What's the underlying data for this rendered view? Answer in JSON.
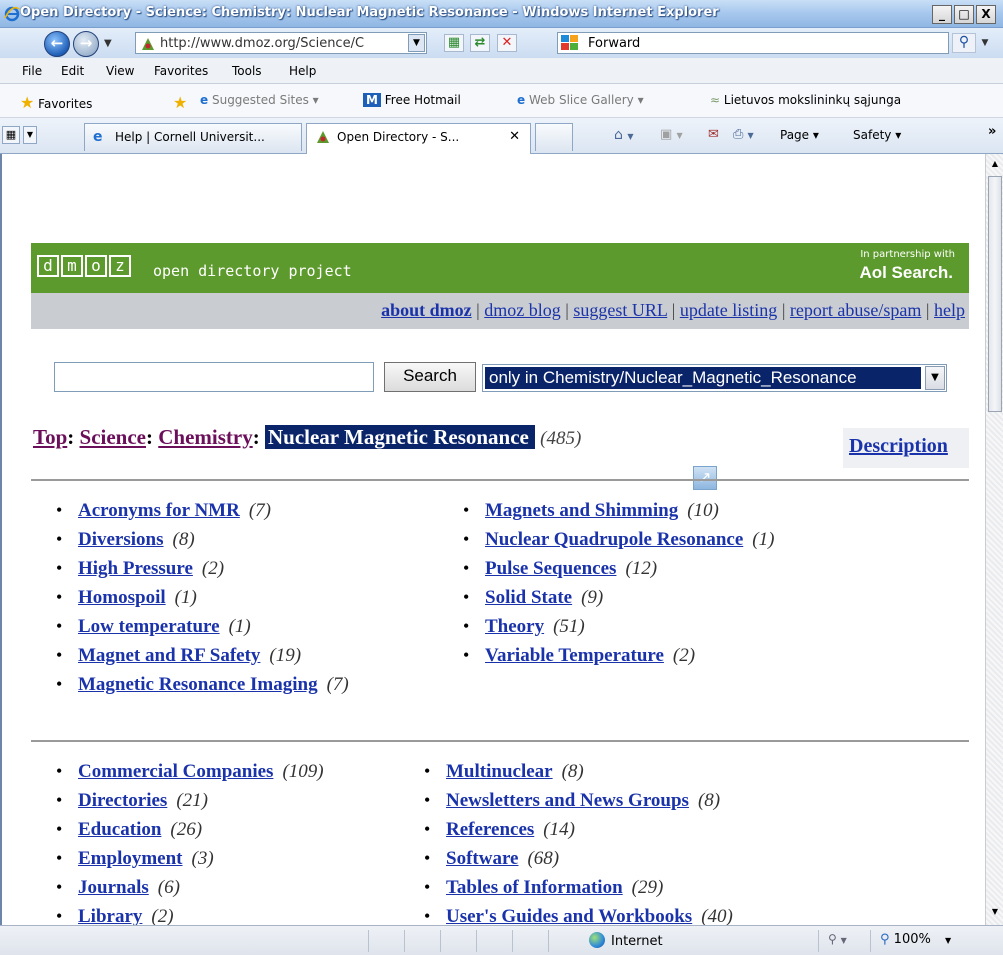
{
  "window": {
    "title": "Open Directory - Science: Chemistry: Nuclear Magnetic Resonance - Windows Internet Explorer",
    "controls": [
      "_",
      "□",
      "X"
    ]
  },
  "navigation": {
    "address": "http://www.dmoz.org/Science/C",
    "search_provider_text": "Forward"
  },
  "menu": [
    "File",
    "Edit",
    "View",
    "Favorites",
    "Tools",
    "Help"
  ],
  "favorites_bar": {
    "favorites_label": "Favorites",
    "items": [
      "Suggested Sites ▾",
      "Free Hotmail",
      "Web Slice Gallery ▾",
      "Lietuvos mokslininkų sąjunga"
    ]
  },
  "tabs": [
    {
      "label": "Help | Cornell Universit..."
    },
    {
      "label": "Open Directory - S..."
    }
  ],
  "command_bar": {
    "page_label": "Page ▾",
    "safety_label": "Safety ▾",
    "more": "»"
  },
  "dmoz": {
    "logo_letters": [
      "d",
      "m",
      "o",
      "z"
    ],
    "tagline": "open directory project",
    "partner_text": "In partnership with",
    "partner_brand": "Aol Search.",
    "links": [
      "about dmoz",
      "dmoz blog",
      "suggest URL",
      "update listing",
      "report abuse/spam",
      "help"
    ],
    "search_button": "Search",
    "search_value": "",
    "scope_selected": "only in Chemistry/Nuclear_Magnetic_Resonance",
    "breadcrumb": {
      "top": "Top",
      "science": "Science",
      "chemistry": "Chemistry",
      "current": "Nuclear Magnetic Resonance",
      "count": "(485)"
    },
    "description_link": "Description"
  },
  "categories_primary_left": [
    {
      "name": "Acronyms for NMR",
      "count": "(7)"
    },
    {
      "name": "Diversions",
      "count": "(8)"
    },
    {
      "name": "High Pressure",
      "count": "(2)"
    },
    {
      "name": "Homospoil",
      "count": "(1)"
    },
    {
      "name": "Low temperature",
      "count": "(1)"
    },
    {
      "name": "Magnet and RF Safety",
      "count": "(19)"
    },
    {
      "name": "Magnetic Resonance Imaging",
      "count": "(7)"
    }
  ],
  "categories_primary_right": [
    {
      "name": "Magnets and Shimming",
      "count": "(10)"
    },
    {
      "name": "Nuclear Quadrupole Resonance",
      "count": "(1)"
    },
    {
      "name": "Pulse Sequences",
      "count": "(12)"
    },
    {
      "name": "Solid State",
      "count": "(9)"
    },
    {
      "name": "Theory",
      "count": "(51)"
    },
    {
      "name": "Variable Temperature",
      "count": "(2)"
    }
  ],
  "categories_secondary_left": [
    {
      "name": "Commercial Companies",
      "count": "(109)"
    },
    {
      "name": "Directories",
      "count": "(21)"
    },
    {
      "name": "Education",
      "count": "(26)"
    },
    {
      "name": "Employment",
      "count": "(3)"
    },
    {
      "name": "Journals",
      "count": "(6)"
    },
    {
      "name": "Library",
      "count": "(2)"
    }
  ],
  "categories_secondary_right": [
    {
      "name": "Multinuclear",
      "count": "(8)"
    },
    {
      "name": "Newsletters and News Groups",
      "count": "(8)"
    },
    {
      "name": "References",
      "count": "(14)"
    },
    {
      "name": "Software",
      "count": "(68)"
    },
    {
      "name": "Tables of Information",
      "count": "(29)"
    },
    {
      "name": "User's Guides and Workbooks",
      "count": "(40)"
    }
  ],
  "status_bar": {
    "zone": "Internet",
    "zoom": "100%"
  },
  "colors": {
    "dmoz_green": "#5d9a2d",
    "link_blue": "#1a33aa",
    "visited_purple": "#6b0f5a",
    "selection_navy": "#0a246a"
  }
}
